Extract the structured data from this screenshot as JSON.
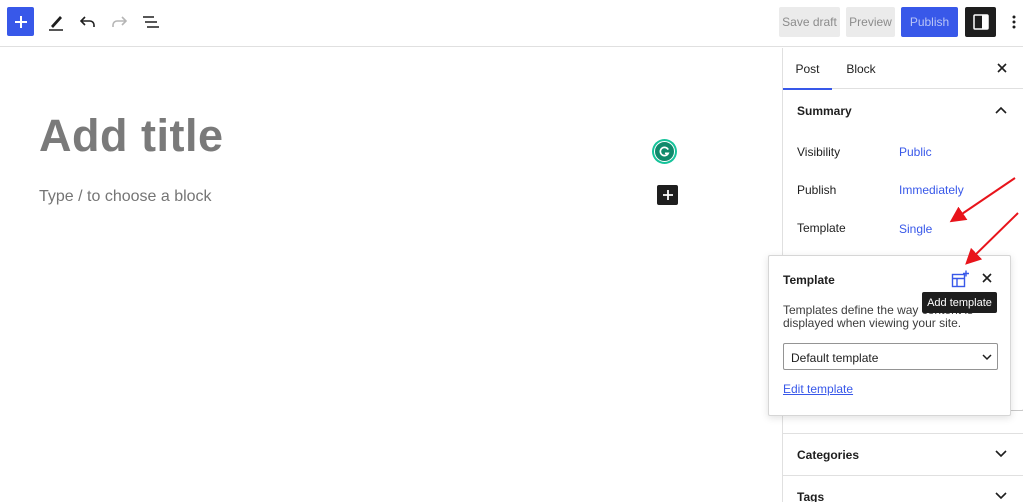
{
  "toolbar": {
    "inserter_icon": "plus-icon",
    "tools_icon": "pencil-icon",
    "undo_icon": "undo-icon",
    "redo_icon": "redo-icon",
    "listview_icon": "list-view-icon",
    "save_draft_label": "Save draft",
    "preview_label": "Preview",
    "publish_label": "Publish",
    "settings_icon": "sidebar-toggle-icon",
    "options_icon": "kebab-menu-icon"
  },
  "editor": {
    "title_placeholder": "Add title",
    "block_placeholder": "Type / to choose a block",
    "grammarly_label": "G"
  },
  "sidebar": {
    "tabs": [
      {
        "label": "Post",
        "active": true
      },
      {
        "label": "Block",
        "active": false
      }
    ],
    "summary": {
      "title": "Summary",
      "rows": [
        {
          "label": "Visibility",
          "value": "Public"
        },
        {
          "label": "Publish",
          "value": "Immediately"
        },
        {
          "label": "Template",
          "value": "Single"
        }
      ]
    },
    "sections": [
      {
        "title": "Categories"
      },
      {
        "title": "Tags"
      }
    ]
  },
  "template_popover": {
    "title": "Template",
    "description": "Templates define the way content is displayed when viewing your site.",
    "select_value": "Default template",
    "edit_link": "Edit template",
    "add_tooltip": "Add template"
  },
  "colors": {
    "accent": "#3858e9",
    "annotation_arrow": "#e8141b"
  }
}
